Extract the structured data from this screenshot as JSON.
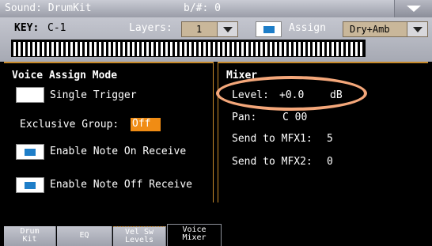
{
  "titlebar": {
    "sound": "Sound: DrumKit",
    "key_sig": "b/#: 0"
  },
  "keybar": {
    "key_label": "KEY:",
    "key_value": "C-1",
    "layers_label": "Layers:",
    "layers_value": "1",
    "assign_label": "Assign",
    "assign_checked": true,
    "fx_value": "Dry+Amb"
  },
  "voice_assign": {
    "title": "Voice Assign Mode",
    "single_trigger": {
      "label": "Single Trigger",
      "checked": false
    },
    "exclusive_group": {
      "label": "Exclusive Group:",
      "value": "Off"
    },
    "note_on": {
      "label": "Enable Note On Receive",
      "checked": true
    },
    "note_off": {
      "label": "Enable Note Off Receive",
      "checked": true
    }
  },
  "mixer": {
    "title": "Mixer",
    "level_label": "Level:",
    "level_value": "+0.0",
    "level_unit": "dB",
    "pan_label": "Pan:",
    "pan_value": "C 00",
    "mfx1_label": "Send to MFX1:",
    "mfx1_value": "5",
    "mfx2_label": "Send to MFX2:",
    "mfx2_value": "0"
  },
  "tabs": [
    {
      "top": "Drum",
      "bottom": "Kit",
      "active": false
    },
    {
      "top": "EQ",
      "bottom": "",
      "active": false
    },
    {
      "top": "Vel Sw",
      "bottom": "Levels",
      "active": false
    },
    {
      "top": "Voice",
      "bottom": "Mixer",
      "active": true
    }
  ],
  "colors": {
    "accent_orange": "#f08c14",
    "check_blue": "#1e7ec8",
    "divider": "#c88a2a",
    "annotation": "#f4a77a"
  }
}
